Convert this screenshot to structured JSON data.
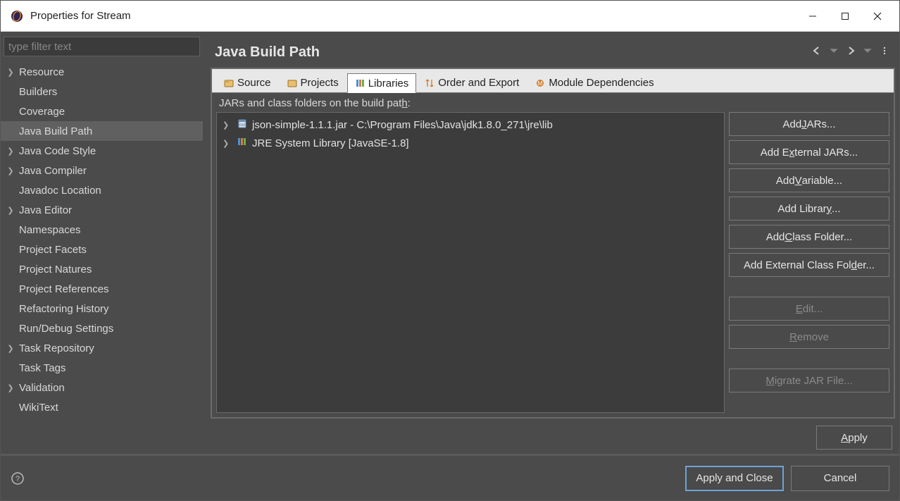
{
  "window": {
    "title": "Properties for Stream"
  },
  "sidebar": {
    "filter_placeholder": "type filter text",
    "items": [
      {
        "label": "Resource",
        "expandable": true
      },
      {
        "label": "Builders",
        "expandable": false
      },
      {
        "label": "Coverage",
        "expandable": false
      },
      {
        "label": "Java Build Path",
        "expandable": false,
        "selected": true
      },
      {
        "label": "Java Code Style",
        "expandable": true
      },
      {
        "label": "Java Compiler",
        "expandable": true
      },
      {
        "label": "Javadoc Location",
        "expandable": false
      },
      {
        "label": "Java Editor",
        "expandable": true
      },
      {
        "label": "Namespaces",
        "expandable": false
      },
      {
        "label": "Project Facets",
        "expandable": false
      },
      {
        "label": "Project Natures",
        "expandable": false
      },
      {
        "label": "Project References",
        "expandable": false
      },
      {
        "label": "Refactoring History",
        "expandable": false
      },
      {
        "label": "Run/Debug Settings",
        "expandable": false
      },
      {
        "label": "Task Repository",
        "expandable": true
      },
      {
        "label": "Task Tags",
        "expandable": false
      },
      {
        "label": "Validation",
        "expandable": true
      },
      {
        "label": "WikiText",
        "expandable": false
      }
    ]
  },
  "main": {
    "title": "Java Build Path",
    "tabs": {
      "source": "Source",
      "projects": "Projects",
      "libraries": "Libraries",
      "order": "Order and Export",
      "modules": "Module Dependencies"
    },
    "list_label_pre": "JARs and class folders on the build pat",
    "list_label_mn": "h",
    "list_label_post": ":",
    "entries": [
      {
        "label": "json-simple-1.1.1.jar - C:\\Program Files\\Java\\jdk1.8.0_271\\jre\\lib",
        "icon": "jar"
      },
      {
        "label": "JRE System Library [JavaSE-1.8]",
        "icon": "library"
      }
    ],
    "buttons": {
      "add_jars": {
        "pre": "Add ",
        "mn": "J",
        "post": "ARs..."
      },
      "add_external_jars": {
        "pre": "Add E",
        "mn": "x",
        "post": "ternal JARs..."
      },
      "add_variable": {
        "pre": "Add ",
        "mn": "V",
        "post": "ariable..."
      },
      "add_library": {
        "pre": "Add Librar",
        "mn": "y",
        "post": "..."
      },
      "add_class_folder": {
        "pre": "Add ",
        "mn": "C",
        "post": "lass Folder..."
      },
      "add_external_class_folder": {
        "pre": "Add External Class Fol",
        "mn": "d",
        "post": "er..."
      },
      "edit": {
        "pre": "",
        "mn": "E",
        "post": "dit..."
      },
      "remove": {
        "pre": "",
        "mn": "R",
        "post": "emove"
      },
      "migrate": {
        "pre": "",
        "mn": "M",
        "post": "igrate JAR File..."
      }
    },
    "apply": {
      "pre": "",
      "mn": "A",
      "post": "pply"
    }
  },
  "footer": {
    "apply_close": "Apply and Close",
    "cancel": "Cancel"
  }
}
